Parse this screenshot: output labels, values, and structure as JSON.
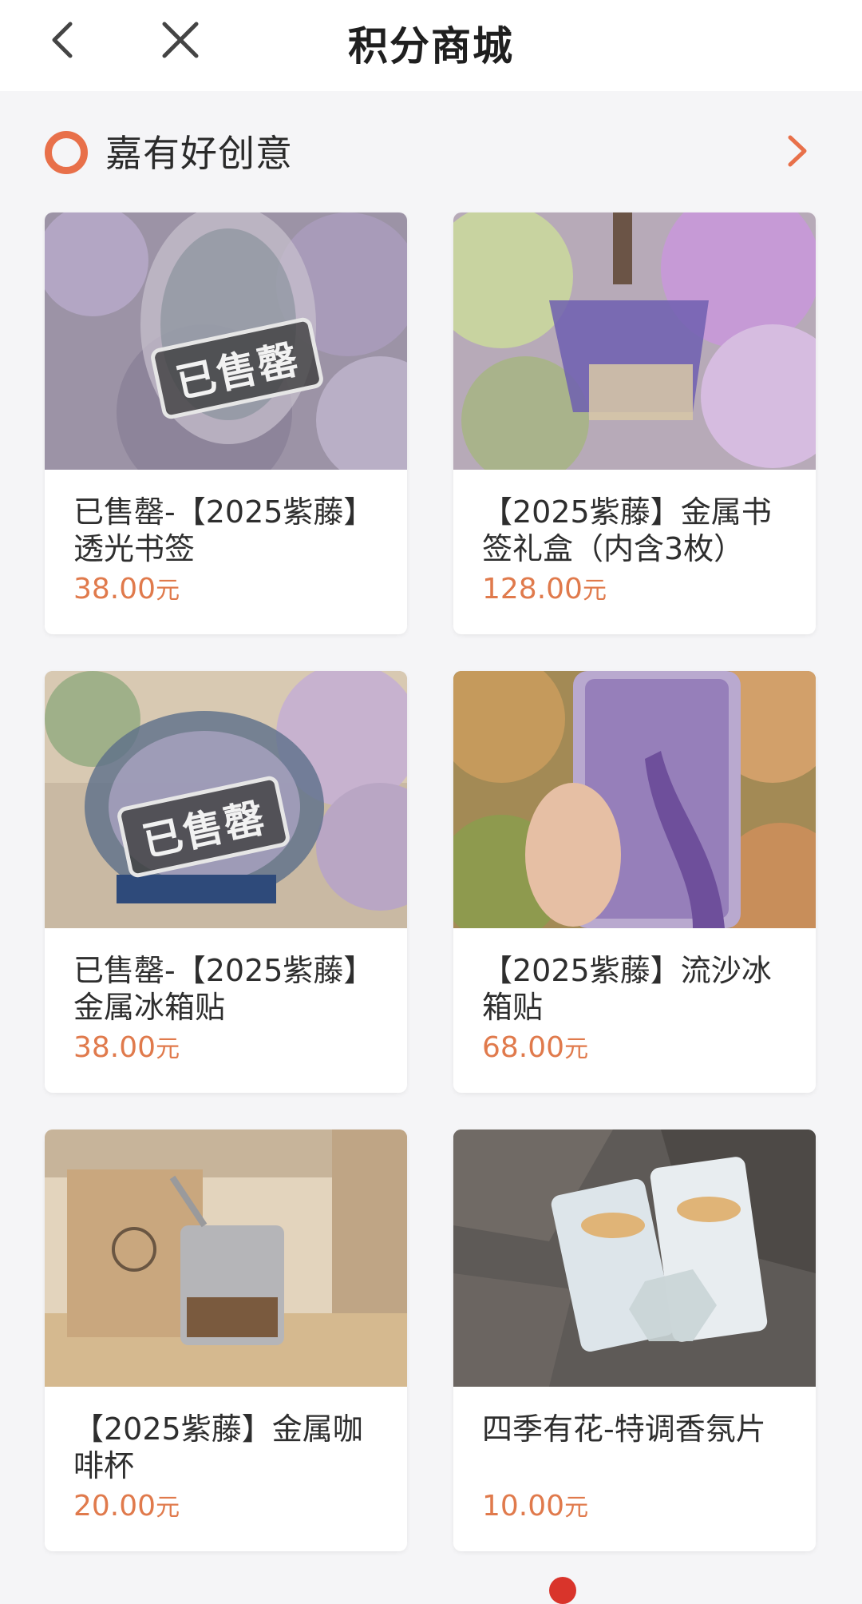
{
  "header": {
    "title": "积分商城"
  },
  "section": {
    "title": "嘉有好创意"
  },
  "products": [
    {
      "name": "已售罄-【2025紫藤】透光书签",
      "price": "38.00",
      "unit": "元",
      "badge": "已售罄"
    },
    {
      "name": "【2025紫藤】金属书签礼盒（内含3枚）",
      "price": "128.00",
      "unit": "元"
    },
    {
      "name": "已售罄-【2025紫藤】金属冰箱贴",
      "price": "38.00",
      "unit": "元",
      "badge": "已售罄"
    },
    {
      "name": "【2025紫藤】流沙冰箱贴",
      "price": "68.00",
      "unit": "元"
    },
    {
      "name": "【2025紫藤】金属咖啡杯",
      "price": "20.00",
      "unit": "元"
    },
    {
      "name": "四季有花-特调香氛片",
      "price": "10.00",
      "unit": "元"
    }
  ],
  "colors": {
    "accent": "#e8704a",
    "price": "#e07a4c",
    "background": "#f5f5f7"
  }
}
